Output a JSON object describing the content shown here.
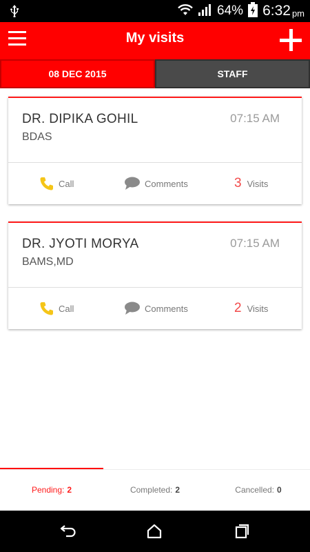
{
  "status_bar": {
    "battery_percent": "64%",
    "time": "6:32",
    "ampm": "pm",
    "icons": [
      "usb-icon",
      "wifi-icon",
      "signal-icon",
      "battery-icon"
    ]
  },
  "app_bar": {
    "title": "My visits",
    "icons": [
      "menu-icon",
      "add-icon"
    ]
  },
  "tabs": [
    {
      "label": "08 DEC 2015",
      "active": true
    },
    {
      "label": "STAFF",
      "active": false
    }
  ],
  "visits": [
    {
      "name": "DR. DIPIKA GOHIL",
      "degree": "BDAS",
      "time": "07:15 AM",
      "call_label": "Call",
      "comments_label": "Comments",
      "visits_count": "3",
      "visits_label": "Visits"
    },
    {
      "name": "DR. JYOTI MORYA",
      "degree": "BAMS,MD",
      "time": "07:15 AM",
      "call_label": "Call",
      "comments_label": "Comments",
      "visits_count": "2",
      "visits_label": "Visits"
    }
  ],
  "bottom_tabs": [
    {
      "label": "Pending:",
      "count": "2",
      "active": true
    },
    {
      "label": "Completed:",
      "count": "2",
      "active": false
    },
    {
      "label": "Cancelled:",
      "count": "0",
      "active": false
    }
  ],
  "colors": {
    "accent": "#ff0000",
    "tab_inactive": "#4a4a4a",
    "call_icon": "#f5c518",
    "comment_icon": "#8a8a8a",
    "visits_count": "#f24a4a"
  },
  "nav_bar": {
    "icons": [
      "back-icon",
      "home-icon",
      "recent-apps-icon"
    ]
  }
}
